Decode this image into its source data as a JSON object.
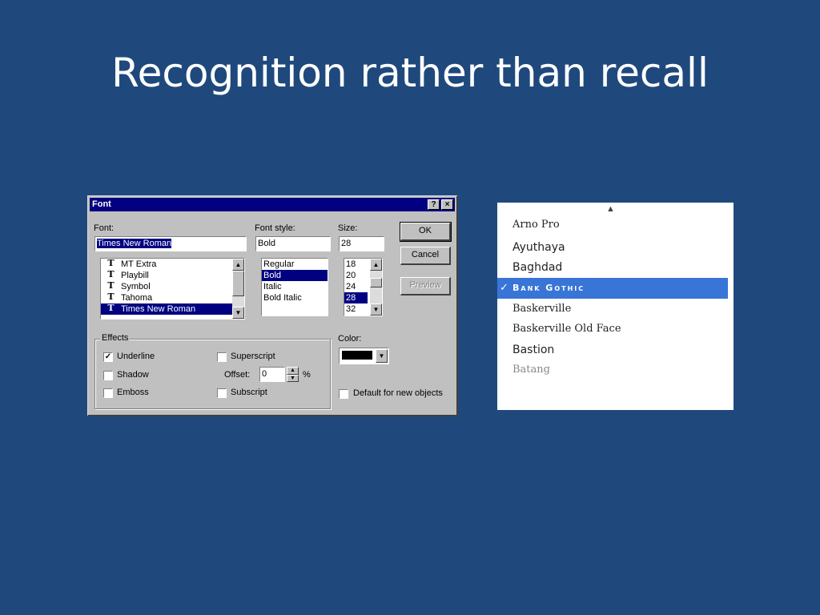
{
  "slide": {
    "title": "Recognition rather than recall",
    "background": "#1f497d"
  },
  "dialog": {
    "title": "Font",
    "help_button": "?",
    "close_button": "×",
    "font_label": "Font:",
    "font_value": "Times New Roman",
    "font_list": [
      {
        "icon": "truetype-icon",
        "name": "MT Extra"
      },
      {
        "icon": "truetype-icon",
        "name": "Playbill"
      },
      {
        "icon": "truetype-icon",
        "name": "Symbol"
      },
      {
        "icon": "truetype-icon",
        "name": "Tahoma"
      },
      {
        "icon": "truetype-icon",
        "name": "Times New Roman",
        "selected": true
      }
    ],
    "style_label": "Font style:",
    "style_value": "Bold",
    "style_list": [
      {
        "name": "Regular"
      },
      {
        "name": "Bold",
        "selected": true
      },
      {
        "name": "Italic"
      },
      {
        "name": "Bold Italic"
      }
    ],
    "size_label": "Size:",
    "size_value": "28",
    "size_list": [
      {
        "name": "18"
      },
      {
        "name": "20"
      },
      {
        "name": "24"
      },
      {
        "name": "28",
        "selected": true
      },
      {
        "name": "32"
      }
    ],
    "ok": "OK",
    "cancel": "Cancel",
    "preview": "Preview",
    "effects": {
      "label": "Effects",
      "underline": {
        "label": "Underline",
        "checked": true
      },
      "shadow": {
        "label": "Shadow",
        "checked": false
      },
      "emboss": {
        "label": "Emboss",
        "checked": false
      },
      "superscript": {
        "label": "Superscript",
        "checked": false
      },
      "subscript": {
        "label": "Subscript",
        "checked": false
      },
      "offset_label": "Offset:",
      "offset_value": "0",
      "offset_unit": "%"
    },
    "color_label": "Color:",
    "color_value": "#000000",
    "default_label": "Default for new objects"
  },
  "mac_menu": {
    "items": [
      {
        "name": "Arno Pro",
        "font": "serif"
      },
      {
        "name": "Ayuthaya",
        "font": "sans"
      },
      {
        "name": "Baghdad",
        "font": "sans"
      },
      {
        "name": "Bank Gothic",
        "font": "gothic",
        "selected": true
      },
      {
        "name": "Baskerville",
        "font": "serif"
      },
      {
        "name": "Baskerville Old Face",
        "font": "serif"
      },
      {
        "name": "Bastion",
        "font": "sans"
      },
      {
        "name": "Batang",
        "font": "serif",
        "dim": true
      }
    ],
    "checkmark": "✓",
    "highlight_color": "#3875d7"
  }
}
